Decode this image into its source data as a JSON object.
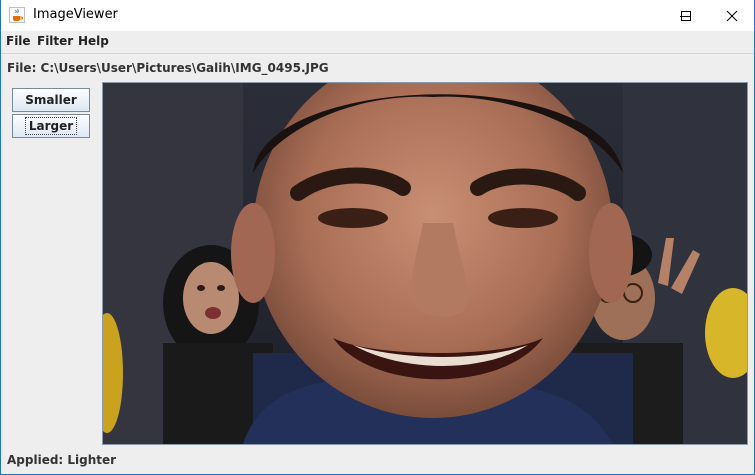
{
  "window": {
    "title": "ImageViewer",
    "accent": "#1f73c8"
  },
  "icons": {
    "app": "java-cup-icon",
    "minimize": "minimize-icon",
    "maximize": "maximize-icon",
    "close": "close-icon"
  },
  "menu": {
    "file": "File",
    "filter": "Filter",
    "help": "Help"
  },
  "file_label": "File: C:\\Users\\User\\Pictures\\Galih\\IMG_0495.JPG",
  "buttons": {
    "smaller": "Smaller",
    "larger": "Larger"
  },
  "status": "Applied: Lighter"
}
